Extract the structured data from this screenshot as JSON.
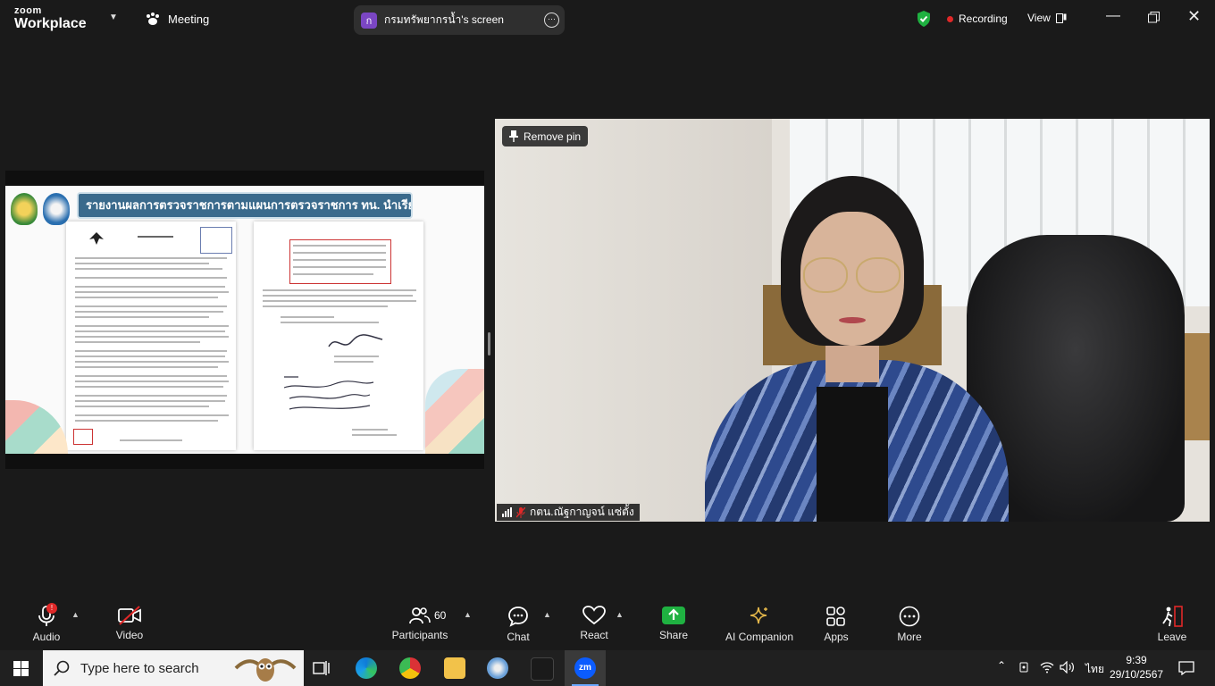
{
  "titlebar": {
    "brand_top": "zoom",
    "brand_bottom": "Workplace",
    "meeting_label": "Meeting",
    "share_avatar_letter": "ก",
    "share_title": "กรมทรัพยากรน้ำ's screen",
    "recording_label": "Recording",
    "view_label": "View"
  },
  "slide": {
    "banner": "รายงานผลการตรวจราชการตามแผนการตรวจราชการ ทน. นำเรียน อทน."
  },
  "video": {
    "pin_label": "Remove pin",
    "participant_name": "กตน.ณัฐกาญจน์ แซ่ตั้ง"
  },
  "toolbar": {
    "audio": "Audio",
    "audio_badge": "!",
    "video": "Video",
    "participants": "Participants",
    "participants_count": "60",
    "chat": "Chat",
    "react": "React",
    "share": "Share",
    "ai": "AI Companion",
    "apps": "Apps",
    "more": "More",
    "leave": "Leave"
  },
  "taskbar": {
    "search_placeholder": "Type here to search",
    "lang": "ไทย",
    "time": "9:39",
    "date": "29/10/2567"
  },
  "colors": {
    "accent_green": "#1fb141",
    "record_red": "#e02828",
    "zoom_blue": "#0b5cff"
  }
}
